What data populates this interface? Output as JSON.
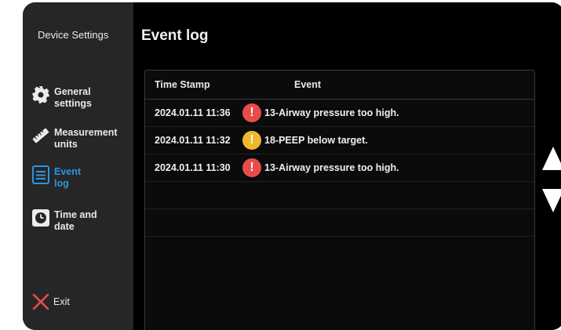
{
  "sidebar": {
    "title": "Device Settings",
    "items": [
      {
        "label_line1": "General",
        "label_line2": "settings",
        "icon": "gear-icon",
        "active": false
      },
      {
        "label_line1": "Measurement",
        "label_line2": "units",
        "icon": "ruler-icon",
        "active": false
      },
      {
        "label_line1": "Event",
        "label_line2": "log",
        "icon": "list-icon",
        "active": true
      },
      {
        "label_line1": "Time and",
        "label_line2": "date",
        "icon": "clock-icon",
        "active": false
      }
    ],
    "exit_label": "Exit"
  },
  "main": {
    "title": "Event log",
    "columns": {
      "timestamp": "Time Stamp",
      "event": "Event"
    },
    "rows": [
      {
        "timestamp": "2024.01.11 11:36",
        "severity": "high",
        "event": "13-Airway pressure too high."
      },
      {
        "timestamp": "2024.01.11 11:32",
        "severity": "medium",
        "event": "18-PEEP below target."
      },
      {
        "timestamp": "2024.01.11 11:30",
        "severity": "high",
        "event": "13-Airway pressure too high."
      }
    ]
  },
  "colors": {
    "active": "#2a95e0",
    "alarm_high": "#e94b4b",
    "alarm_medium": "#f0b82e",
    "exit_icon": "#e94b4b"
  },
  "icons": {
    "scroll_up": "triangle-up-icon",
    "scroll_down": "triangle-down-icon",
    "severity": "exclamation-icon"
  }
}
